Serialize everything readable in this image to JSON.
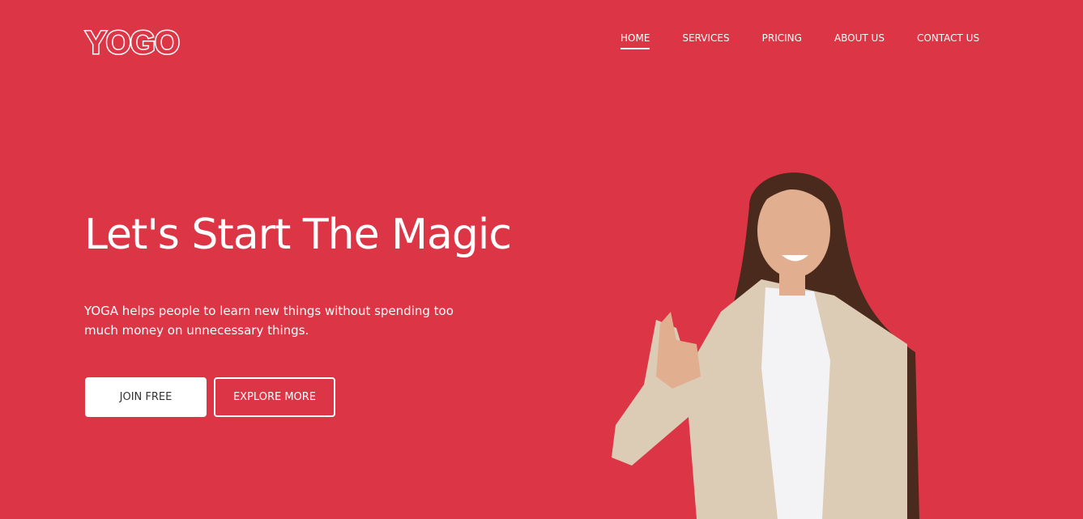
{
  "logo": "YOGO",
  "nav": [
    {
      "label": "HOME",
      "active": true
    },
    {
      "label": "SERVICES"
    },
    {
      "label": "PRICING"
    },
    {
      "label": "ABOUT US"
    },
    {
      "label": "CONTACT US"
    }
  ],
  "hero": {
    "title": "Let's Start The Magic",
    "description": "YOGA helps people to learn new things without spending too much money on unnecessary things.",
    "join_label": "JOIN FREE",
    "explore_label": "EXPLORE MORE"
  },
  "colors": {
    "background": "#dc3545",
    "text": "#ffffff"
  }
}
